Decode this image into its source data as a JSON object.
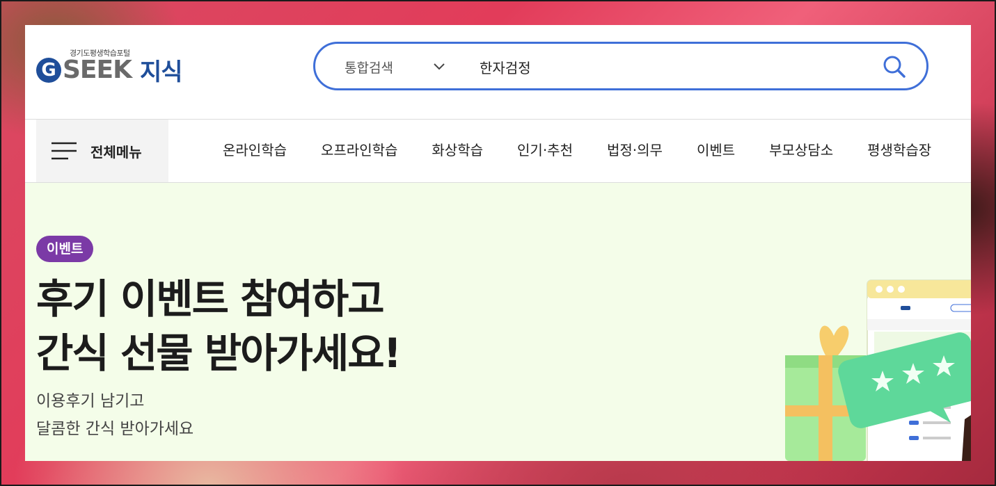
{
  "logo": {
    "subtitle": "경기도평생학습포털",
    "g": "G",
    "seek": "SEEK",
    "jisik": "지식"
  },
  "search": {
    "type": "통합검색",
    "query": "한자검정"
  },
  "nav": {
    "all_menu": "전체메뉴",
    "items": [
      "온라인학습",
      "오프라인학습",
      "화상학습",
      "인기·추천",
      "법정·의무",
      "이벤트",
      "부모상담소",
      "평생학습장"
    ]
  },
  "banner": {
    "badge": "이벤트",
    "headline_1": "후기 이벤트 참여하고",
    "headline_2": "간식 선물 받아가세요!",
    "sub_1": "이용후기 남기고",
    "sub_2": "달콤한 간식 받아가세요"
  },
  "colors": {
    "brand_blue": "#1f4e9a",
    "search_border": "#3f6fd8",
    "badge_purple": "#7b3aa6",
    "banner_bg": "#f4fde9"
  },
  "icons": {
    "search": "search-icon",
    "chevron": "chevron-down-icon",
    "menu": "hamburger-icon"
  }
}
